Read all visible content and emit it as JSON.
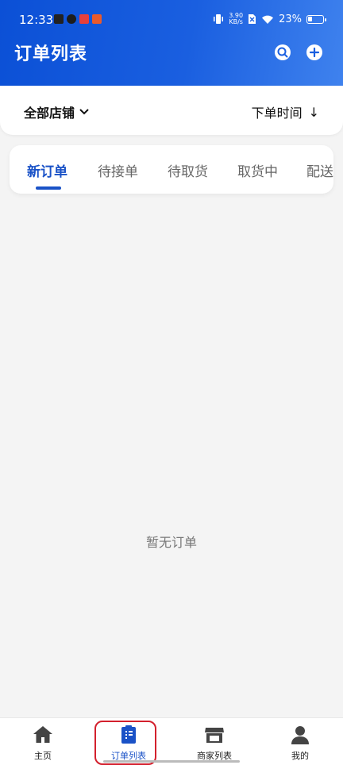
{
  "status_bar": {
    "time": "12:33",
    "net_speed_top": "3.90",
    "net_speed_bottom": "KB/s",
    "battery": "23%",
    "battery_level": 0.23
  },
  "header": {
    "title": "订单列表",
    "search_icon": "search-icon",
    "add_icon": "add-circle-icon"
  },
  "filter": {
    "store": "全部店铺",
    "sort": "下单时间",
    "sort_arrow": "↓"
  },
  "tabs": [
    {
      "label": "新订单",
      "active": true
    },
    {
      "label": "待接单",
      "active": false
    },
    {
      "label": "待取货",
      "active": false
    },
    {
      "label": "取货中",
      "active": false
    },
    {
      "label": "配送",
      "active": false
    }
  ],
  "empty_text": "暂无订单",
  "bottom_nav": [
    {
      "label": "主页",
      "icon": "home-icon",
      "active": false
    },
    {
      "label": "订单列表",
      "icon": "clipboard-icon",
      "active": true
    },
    {
      "label": "商家列表",
      "icon": "store-icon",
      "active": false
    },
    {
      "label": "我的",
      "icon": "person-icon",
      "active": false
    }
  ],
  "colors": {
    "primary": "#1a52c7",
    "highlight": "#d3202d"
  }
}
